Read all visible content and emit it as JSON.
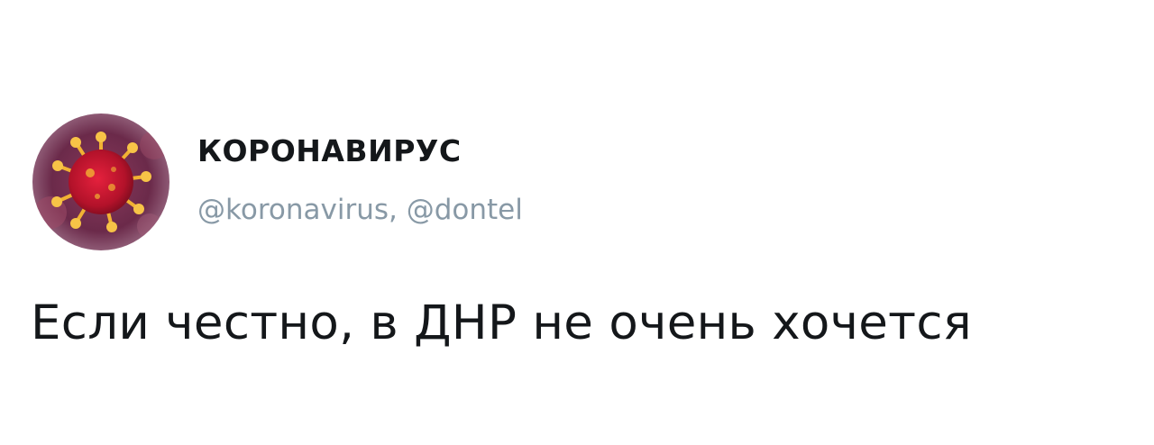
{
  "author": {
    "avatar_icon": "coronavirus-avatar-icon",
    "name": "КОРОНАВИРУС",
    "handles": [
      "@koronavirus",
      "@dontel"
    ],
    "handle_separator": ", "
  },
  "tweet": {
    "text": "Если честно, в ДНР не очень хочется"
  },
  "colors": {
    "name": "#14171a",
    "handle": "#8899a6",
    "text": "#14171a",
    "background": "#ffffff",
    "avatar_bg": "#6b2a4a",
    "avatar_virus": "#c0172f",
    "avatar_spikes": "#f2b233"
  }
}
